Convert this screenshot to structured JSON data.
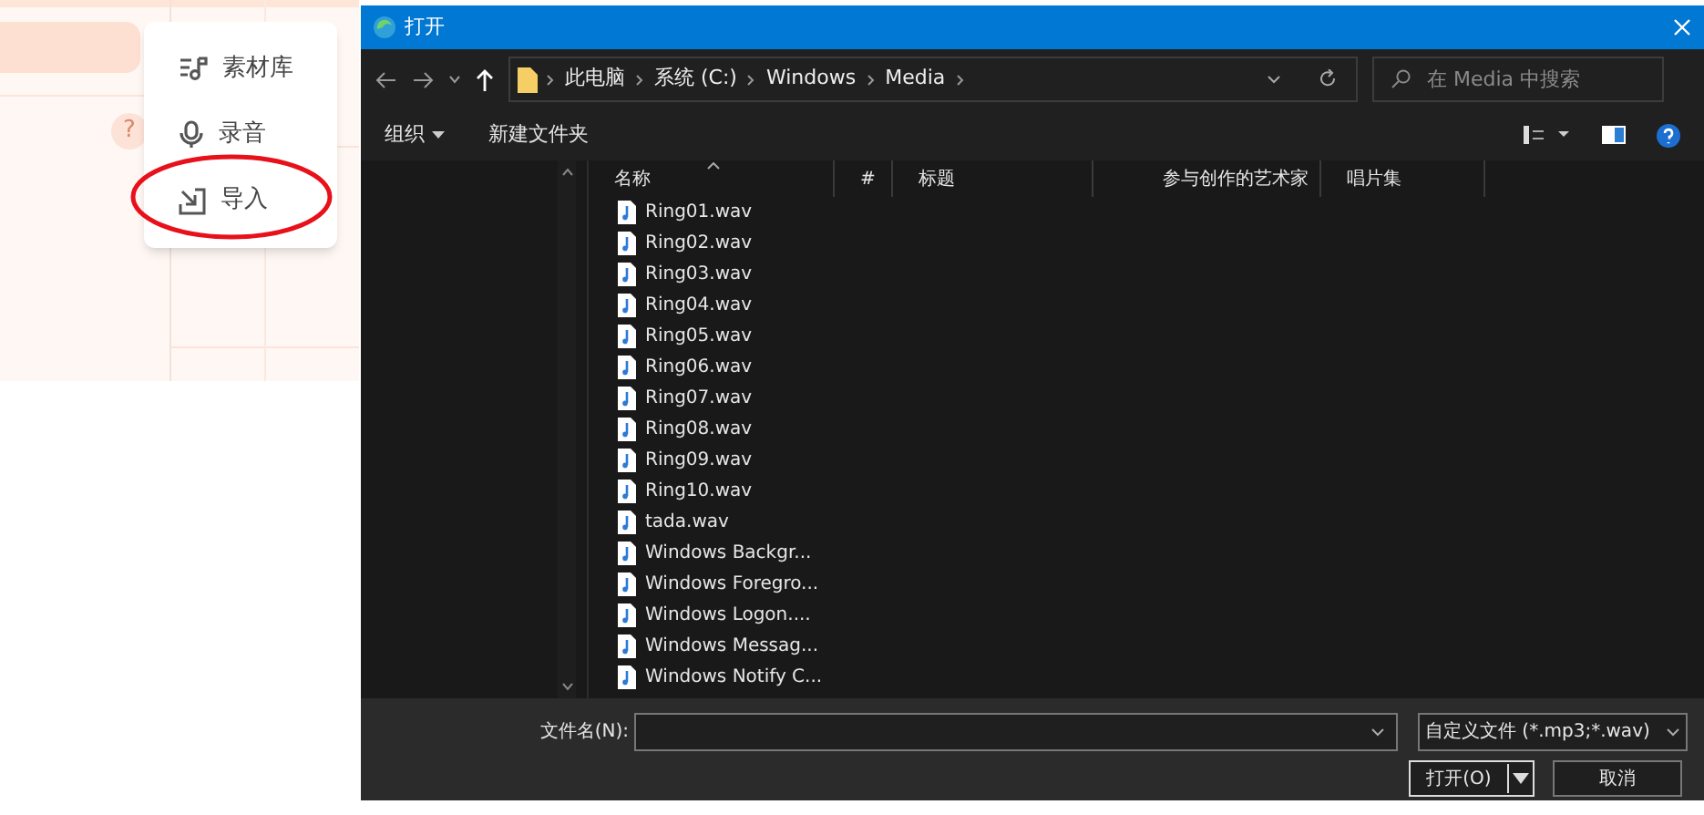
{
  "app_menu": {
    "items": [
      {
        "kind": "library",
        "label": "素材库"
      },
      {
        "kind": "record",
        "label": "录音"
      },
      {
        "kind": "import",
        "label": "导入",
        "circled": true
      }
    ]
  },
  "help_badge": "?",
  "dialog": {
    "title": "打开",
    "breadcrumbs": [
      "此电脑",
      "系统 (C:)",
      "Windows",
      "Media"
    ],
    "search": {
      "placeholder": "在 Media 中搜索"
    },
    "toolbar": [
      "组织",
      "新建文件夹"
    ],
    "columns": [
      "名称",
      "#",
      "标题",
      "参与创作的艺术家",
      "唱片集"
    ],
    "files": [
      "Ring01.wav",
      "Ring02.wav",
      "Ring03.wav",
      "Ring04.wav",
      "Ring05.wav",
      "Ring06.wav",
      "Ring07.wav",
      "Ring08.wav",
      "Ring09.wav",
      "Ring10.wav",
      "tada.wav",
      "Windows Backgr...",
      "Windows Foregro...",
      "Windows Logon....",
      "Windows Messag...",
      "Windows Notify C..."
    ],
    "filename_label": "文件名(N):",
    "file_type": "自定义文件 (*.mp3;*.wav)",
    "buttons": [
      "打开(O)",
      "取消"
    ]
  }
}
